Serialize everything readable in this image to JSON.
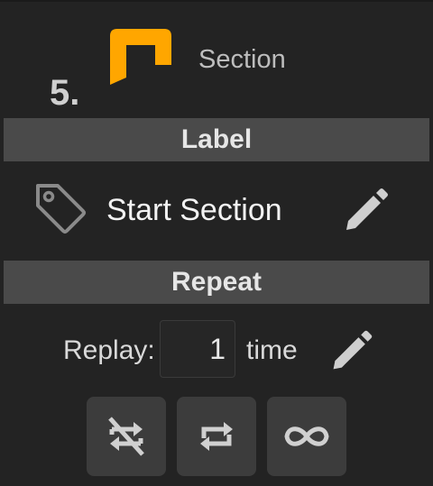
{
  "section": {
    "step_number": "5.",
    "type_label": "Section",
    "logo_icon": "section-bracket-icon",
    "accent_color": "#ffa600"
  },
  "label_band": {
    "title": "Label",
    "value": "Start Section",
    "tag_icon": "tag-icon",
    "edit_icon": "pencil-icon"
  },
  "repeat_band": {
    "title": "Repeat",
    "replay_label": "Replay:",
    "replay_count": "1",
    "replay_unit": "time",
    "edit_icon": "pencil-icon",
    "modes": [
      {
        "name": "no-repeat",
        "icon": "repeat-off-icon"
      },
      {
        "name": "repeat",
        "icon": "repeat-icon"
      },
      {
        "name": "infinite",
        "icon": "infinity-icon"
      }
    ]
  }
}
